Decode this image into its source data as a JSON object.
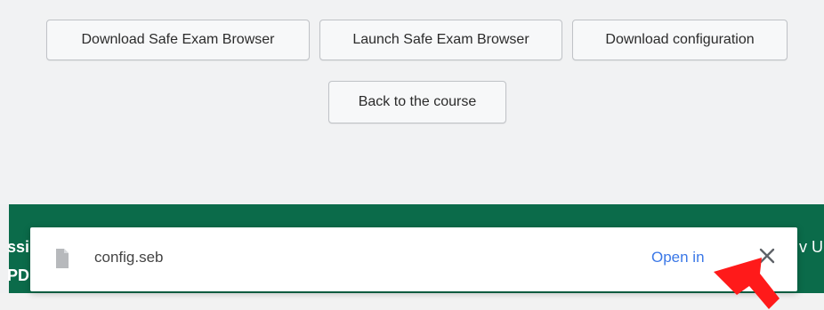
{
  "buttons": {
    "download_seb": "Download Safe Exam Browser",
    "launch_seb": "Launch Safe Exam Browser",
    "download_config": "Download configuration",
    "back_to_course": "Back to the course"
  },
  "footer": {
    "left_line1": "ssi",
    "left_line2": "PD",
    "right_text": "v U"
  },
  "download_bar": {
    "file_icon": "file-icon",
    "file_name": "config.seb",
    "open_label": "Open in",
    "close_icon": "close-icon"
  },
  "overlay": {
    "arrow_icon": "red-arrow-pointer-icon"
  },
  "colors": {
    "footer_green": "#0b6b4a",
    "link_blue": "#3b78e7",
    "arrow_red": "#ff1a1a"
  }
}
